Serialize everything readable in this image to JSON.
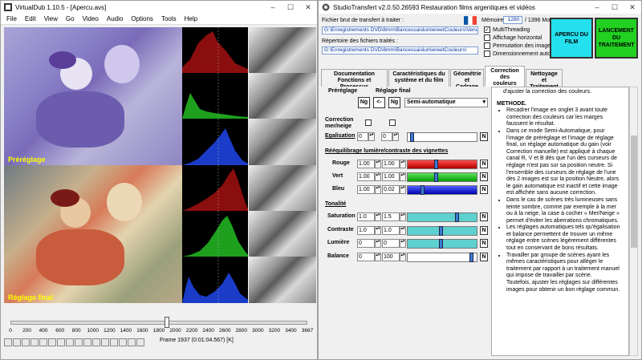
{
  "virtualdub": {
    "title": "VirtualDub 1.10.5 - [Apercu.avs]",
    "menu": [
      "File",
      "Edit",
      "View",
      "Go",
      "Video",
      "Audio",
      "Options",
      "Tools",
      "Help"
    ],
    "top_label": "Préréglage",
    "bottom_label": "Réglage final",
    "timeline_ticks": [
      "0",
      "200",
      "400",
      "600",
      "800",
      "1000",
      "1200",
      "1400",
      "1600",
      "1800",
      "2000",
      "2200",
      "2400",
      "2600",
      "2800",
      "3000",
      "3200",
      "3400",
      "3667"
    ],
    "timeline_position": 0.528,
    "frame_label": "Frame 1937 (0:01:04.567) [K]"
  },
  "studio": {
    "title": "StudioTransfert v2.0.50.26593 Restauration films argentiques et vidéos",
    "source_label": "Fichier brut de transfert à traiter :",
    "source_path": "G:\\Enregistrements DVD\\8mm\\BancessaislumiereetCouleurs\\VenuDa",
    "dest_label": "Répertoire des fichiers traités :",
    "dest_path": "G:\\Enregistrements DVD\\8mm\\BancessaislumiereetCouleurs\\",
    "memory_label": "Mémoire",
    "memory_value": "1280",
    "memory_total": "/ 1396 Mo",
    "options": [
      {
        "label": "MultiThreading",
        "checked": true
      },
      {
        "label": "Affichage horizontal",
        "checked": false
      },
      {
        "label": "Permutation des images",
        "checked": false
      },
      {
        "label": "Dimensionnement auto",
        "checked": false
      }
    ],
    "preview_button": "APERCU DU FILM",
    "launch_button": "LANCEMENT DU TRAITEMENT",
    "tabs": [
      "Documentation Fonctions et Processus",
      "Caractéristiques du système et du film",
      "Géométrie et Cadrage",
      "Correction des couleurs",
      "Nettoyage et Traitement"
    ],
    "panel": {
      "prereg_label": "Préréglage",
      "final_label": "Réglage final",
      "ng1": "Ng",
      "copy_arrow": "<-",
      "ng2": "Ng",
      "mode_value": "Semi-automatique",
      "correction_label": "Correction mer/neige",
      "egalisation_label": "Egalisation",
      "egalisation_value": "0",
      "rebalance_title": "Rééquilibrage lumière/contraste des vignettes",
      "rouge_label": "Rouge",
      "rouge_pre": "1.00",
      "rouge_fin": "1.00",
      "vert_label": "Vert",
      "vert_pre": "1.00",
      "vert_fin": "1.00",
      "bleu_label": "Bleu",
      "bleu_pre": "1.00",
      "bleu_fin": "0.02",
      "tonalite_title": "Tonalité",
      "saturation_label": "Saturation",
      "saturation_pre": "1.0",
      "saturation_fin": "1.5",
      "contraste_label": "Contraste",
      "contraste_pre": "1.0",
      "contraste_fin": "1.0",
      "lumiere_label": "Lumière",
      "lumiere_pre": "0",
      "lumiere_fin": "0",
      "balance_label": "Balance",
      "balance_pre": "0",
      "balance_fin": "100",
      "n_label": "N"
    },
    "help_intro": "d'ajuster la correction des couleurs.",
    "help_heading": "METHODE.",
    "help_items": [
      "Recadrer l'image en onglet 3 avant toute correction des couleurs car les marges faussent le résultat.",
      "Dans ce mode Semi-Automatique, pour l'image de préréglage et l'image de réglage final, un réglage automatique du gain (voir Correction manuelle) est appliqué à chaque canal R, V et B dès que l'un des curseurs de réglage n'est pas sur sa position neutre. Si l'ensemble des curseurs de réglage de l'une des 2 images est sur la position Neutre, alors le gain automatique est inactif et cette image est affichée sans aucune correction.",
      "Dans le cas de scènes très lumineuses sans teinte sombre, comme par exemple à la mer ou à la neige, la case à cocher « Mer/Neige » permet d'éviter les aberrations chromatiques.",
      "Les réglages automatiques tels qu'égalisation et balance permettent de trouver un même réglage entre scènes légèrement différentes tout en conservant de bons résultats.",
      "Travailler par groupe de scènes ayant les mêmes caractéristiques pour alléger le traitement par rapport à un traitement manuel qui impose de travailler par scène."
    ],
    "help_tail": "Toutefois, ajuster les réglages sur différentes images pour obtenir un bon réglage commun."
  }
}
